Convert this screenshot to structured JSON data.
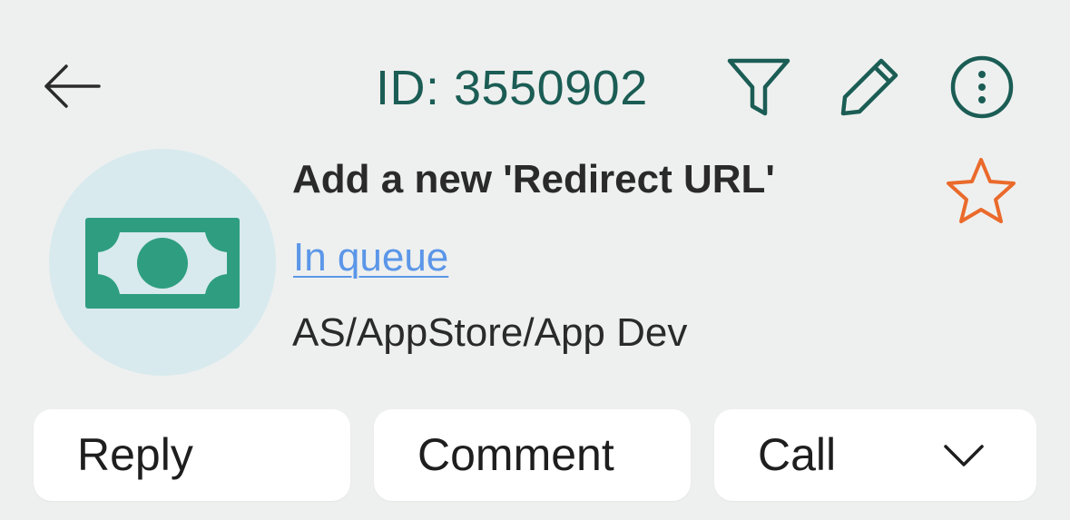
{
  "header": {
    "ticket_id": "ID: 3550902",
    "icons": {
      "back": "arrow-left-icon",
      "filter": "filter-icon",
      "edit": "pencil-icon",
      "more": "more-vertical-icon"
    }
  },
  "ticket": {
    "title": "Add a new 'Redirect URL'",
    "status": "In queue",
    "path": "AS/AppStore/App Dev",
    "avatar_icon": "money-bill-icon",
    "star_icon": "star-outline-icon"
  },
  "actions": {
    "reply_label": "Reply",
    "comment_label": "Comment",
    "call_label": "Call",
    "call_dropdown_icon": "chevron-down-icon"
  },
  "colors": {
    "accent": "#1b5d55",
    "link": "#5b96e8",
    "star": "#ea6a2b",
    "avatar_bg": "#d8eaee",
    "money_green": "#2f9e80",
    "background": "#eef0ef"
  }
}
